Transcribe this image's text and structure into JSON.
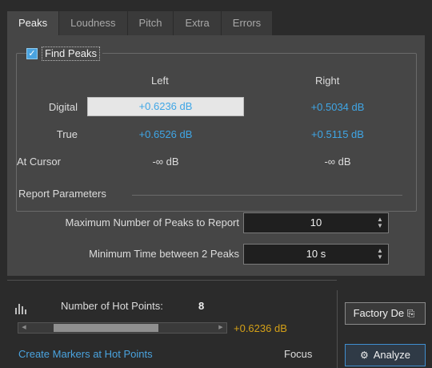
{
  "tabs": [
    {
      "label": "Peaks",
      "active": true
    },
    {
      "label": "Loudness"
    },
    {
      "label": "Pitch"
    },
    {
      "label": "Extra"
    },
    {
      "label": "Errors"
    }
  ],
  "find_peaks": {
    "label": "Find Peaks",
    "checked": true
  },
  "columns": {
    "left": "Left",
    "right": "Right"
  },
  "rows": {
    "digital": {
      "label": "Digital",
      "left": "+0.6236 dB",
      "right": "+0.5034 dB"
    },
    "true": {
      "label": "True",
      "left": "+0.6526 dB",
      "right": "+0.5115 dB"
    },
    "cursor": {
      "label": "At Cursor",
      "left": "-∞ dB",
      "right": "-∞ dB"
    }
  },
  "report": {
    "title": "Report Parameters",
    "max_peaks_label": "Maximum Number of Peaks to Report",
    "max_peaks_value": "10",
    "min_time_label": "Minimum Time between 2 Peaks",
    "min_time_value": "10 s"
  },
  "hot_points": {
    "label": "Number of Hot Points:",
    "count": "8",
    "value": "+0.6236 dB",
    "create_markers": "Create Markers at Hot Points",
    "focus": "Focus"
  },
  "buttons": {
    "factory": "Factory De",
    "analyze": "Analyze"
  },
  "colors": {
    "accent_blue": "#3fa6e6",
    "hot_value": "#d4a017"
  }
}
